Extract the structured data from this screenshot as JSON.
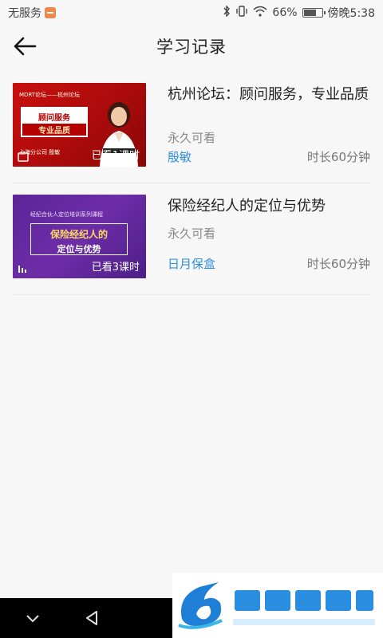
{
  "status_bar": {
    "carrier": "无服务",
    "battery": "66%",
    "battery_level": 0.66,
    "time": "傍晚5:38",
    "icons": [
      "bluetooth-icon",
      "vibrate-icon",
      "wifi-icon",
      "battery-icon"
    ]
  },
  "header": {
    "back_icon": "arrow-left-icon",
    "title": "学习记录"
  },
  "records": [
    {
      "title": "杭州论坛：顾问服务，专业品质",
      "permission": "永久可看",
      "author": "殷敏",
      "duration": "时长60分钟",
      "thumbnail": {
        "theme": "#c8100f",
        "top_text": "MDRT论坛——杭州论坛",
        "line1": "顾问服务",
        "line2": "专业品质",
        "bottom_text": "上海分公司  殷敏",
        "watched": "已看1课时"
      }
    },
    {
      "title": "保险经纪人的定位与优势",
      "permission": "永久可看",
      "author": "日月保盒",
      "duration": "时长60分钟",
      "thumbnail": {
        "theme": "#5a2597",
        "top_text": "经纪合伙人定位培训系列课程",
        "line1": "保险经纪人的",
        "line2": "定位与优势",
        "watched": "已看3课时"
      }
    }
  ],
  "nav": {
    "icons": [
      "chevron-down-icon",
      "back-triangle-icon"
    ]
  },
  "accent_color": "#2f8fd8"
}
